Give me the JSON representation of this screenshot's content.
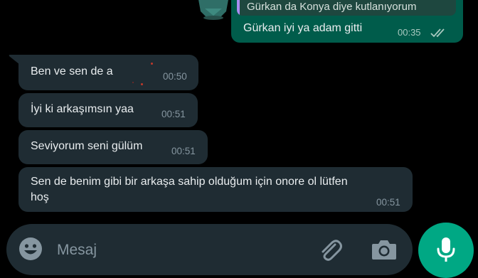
{
  "outgoing": {
    "reply_preview_text": "Gürkan da Konya diye kutlanıyorum",
    "text": "Gürkan iyi ya adam gitti",
    "time": "00:35",
    "status": "delivered-double-check"
  },
  "incoming": [
    {
      "text": "Ben ve sen de a",
      "time": "00:50"
    },
    {
      "text": "İyi ki arkaşımsın yaa",
      "time": "00:51"
    },
    {
      "text": "Seviyorum seni gülüm",
      "time": "00:51"
    },
    {
      "text_line1": "Sen de benim gibi bir arkaşa sahip olduğum için onore ol lütfen",
      "text_line2": "hoş",
      "time": "00:51"
    }
  ],
  "composer": {
    "placeholder": "Mesaj",
    "icons": [
      "emoji-icon",
      "attach-icon",
      "camera-icon",
      "mic-icon"
    ]
  },
  "colors": {
    "background": "#000000",
    "incoming_bubble": "#1f2c33",
    "outgoing_bubble": "#005c4b",
    "accent": "#00a884"
  }
}
